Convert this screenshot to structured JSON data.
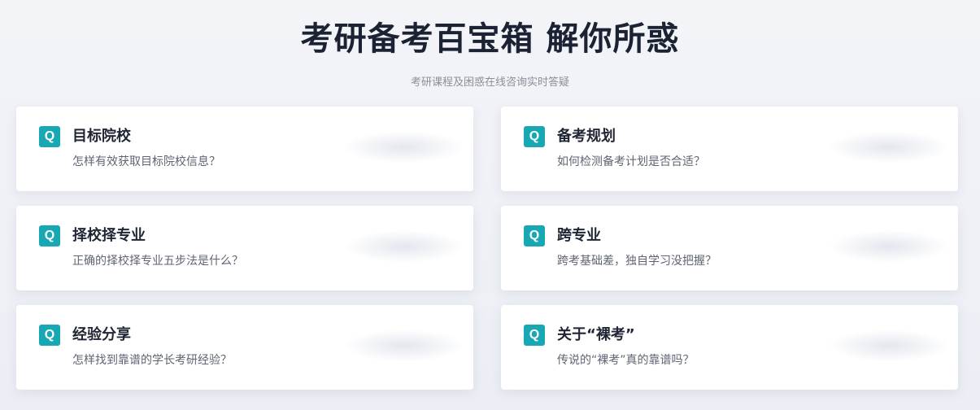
{
  "header": {
    "title": "考研备考百宝箱 解你所惑",
    "subtitle": "考研课程及困惑在线咨询实时答疑"
  },
  "cards": [
    {
      "badge": "Q",
      "title": "目标院校",
      "desc": "怎样有效获取目标院校信息？"
    },
    {
      "badge": "Q",
      "title": "备考规划",
      "desc": "如何检测备考计划是否合适？"
    },
    {
      "badge": "Q",
      "title": "择校择专业",
      "desc": "正确的择校择专业五步法是什么？"
    },
    {
      "badge": "Q",
      "title": "跨专业",
      "desc": "跨考基础差，独自学习没把握？"
    },
    {
      "badge": "Q",
      "title": "经验分享",
      "desc": "怎样找到靠谱的学长考研经验？"
    },
    {
      "badge": "Q",
      "title": "关于“裸考”",
      "desc": "传说的“裸考”真的靠谱吗？"
    }
  ],
  "colors": {
    "accent": "#17a8b3",
    "title": "#1b2233",
    "background": "#f0f1f6"
  }
}
